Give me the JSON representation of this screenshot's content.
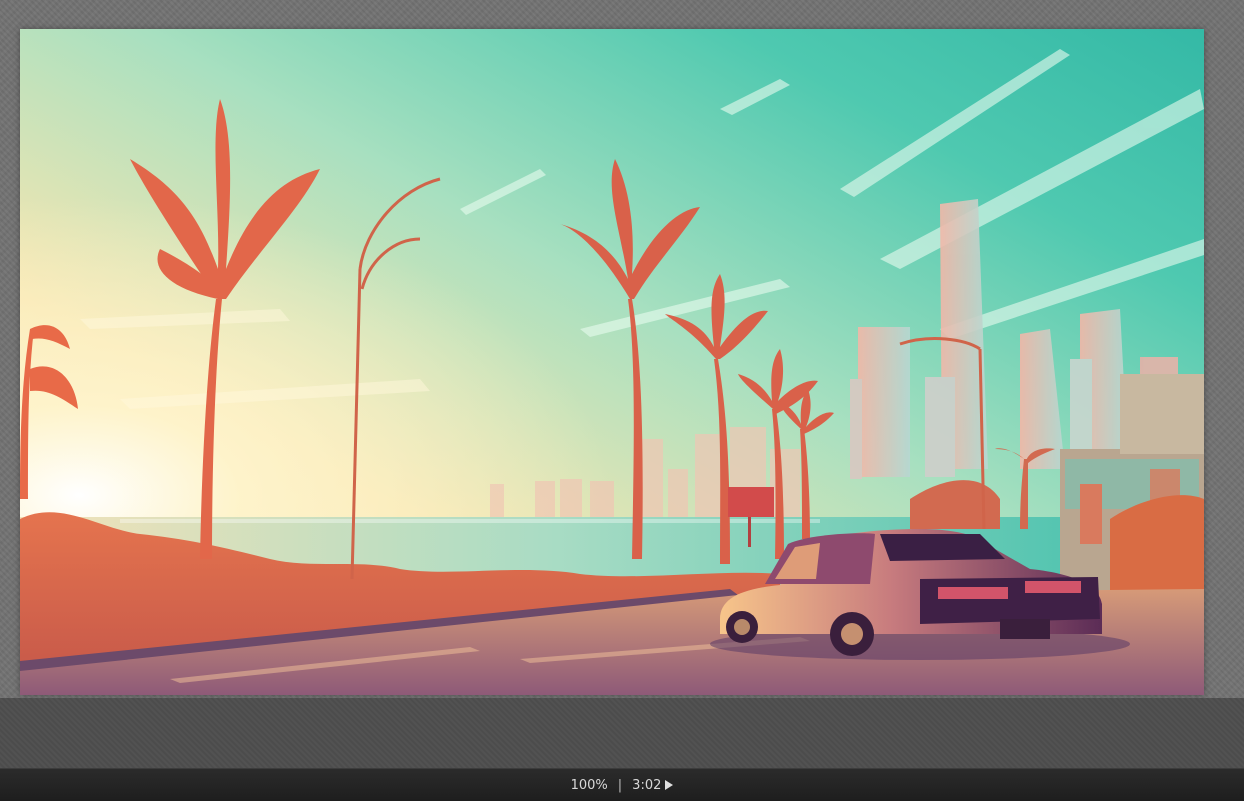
{
  "viewer": {
    "background_color": "#727272"
  },
  "status_bar": {
    "zoom": "100%",
    "separator": "|",
    "duration": "3:02",
    "play_icon": "play-icon"
  }
}
